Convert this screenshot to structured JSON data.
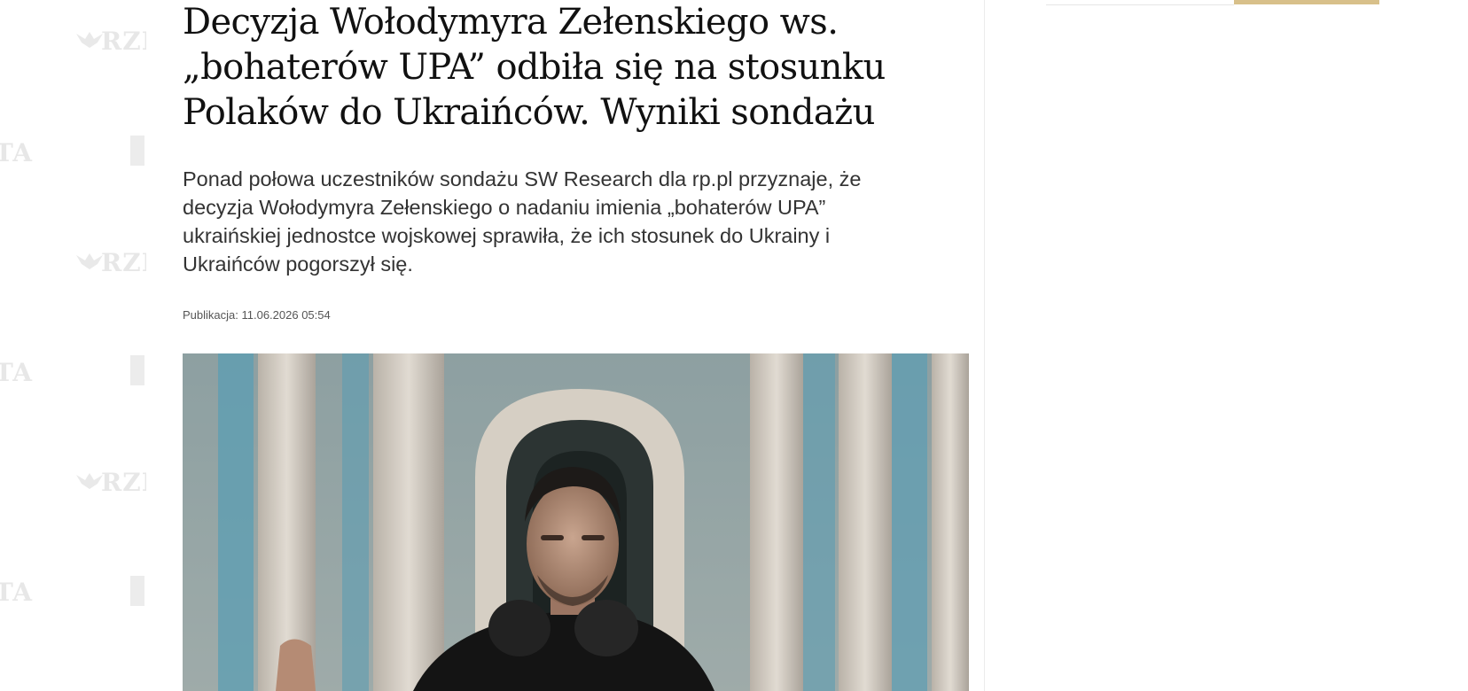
{
  "article": {
    "headline": "Decyzja Wołodymyra Zełenskiego ws. „bohaterów UPA” odbiła się na stosunku Polaków do Ukraińców. Wyniki sondażu",
    "lead": "Ponad połowa uczestników sondażu SW Research dla rp.pl przyznaje, że decyzja Wołodymyra Zełenskiego o nadaniu imienia „bohaterów UPA” ukraińskiej jednostce wojskowej sprawiła, że ich stosunek do Ukrainy i Ukraińców pogorszył się.",
    "publication": "Publikacja: 11.06.2026 05:54"
  },
  "watermark": {
    "top_text": "RZE",
    "side_text": "TA"
  },
  "colors": {
    "accent_gold": "#d8c08a",
    "text_dark": "#111111",
    "text_body": "#333333"
  },
  "icons": {
    "watermark": "rzeczpospolita-eagle-icon"
  }
}
